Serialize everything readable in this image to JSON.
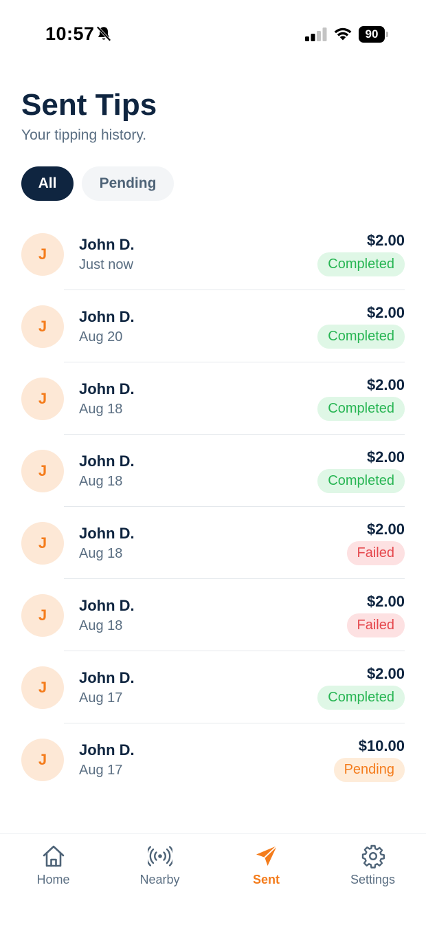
{
  "status_bar": {
    "time": "10:57",
    "battery": "90"
  },
  "header": {
    "title": "Sent Tips",
    "subtitle": "Your tipping history."
  },
  "filters": [
    {
      "label": "All",
      "active": true
    },
    {
      "label": "Pending",
      "active": false
    }
  ],
  "tips": [
    {
      "initial": "J",
      "name": "John D.",
      "date": "Just now",
      "amount": "$2.00",
      "status": "Completed"
    },
    {
      "initial": "J",
      "name": "John D.",
      "date": "Aug 20",
      "amount": "$2.00",
      "status": "Completed"
    },
    {
      "initial": "J",
      "name": "John D.",
      "date": "Aug 18",
      "amount": "$2.00",
      "status": "Completed"
    },
    {
      "initial": "J",
      "name": "John D.",
      "date": "Aug 18",
      "amount": "$2.00",
      "status": "Completed"
    },
    {
      "initial": "J",
      "name": "John D.",
      "date": "Aug 18",
      "amount": "$2.00",
      "status": "Failed"
    },
    {
      "initial": "J",
      "name": "John D.",
      "date": "Aug 18",
      "amount": "$2.00",
      "status": "Failed"
    },
    {
      "initial": "J",
      "name": "John D.",
      "date": "Aug 17",
      "amount": "$2.00",
      "status": "Completed"
    },
    {
      "initial": "J",
      "name": "John D.",
      "date": "Aug 17",
      "amount": "$10.00",
      "status": "Pending"
    }
  ],
  "nav": [
    {
      "label": "Home",
      "icon": "home-icon",
      "active": false
    },
    {
      "label": "Nearby",
      "icon": "broadcast-icon",
      "active": false
    },
    {
      "label": "Sent",
      "icon": "paper-plane-icon",
      "active": true
    },
    {
      "label": "Settings",
      "icon": "gear-icon",
      "active": false
    }
  ],
  "colors": {
    "primary_dark": "#0f2540",
    "accent_orange": "#f47c1c",
    "completed_text": "#27b553",
    "failed_text": "#e5484d"
  }
}
